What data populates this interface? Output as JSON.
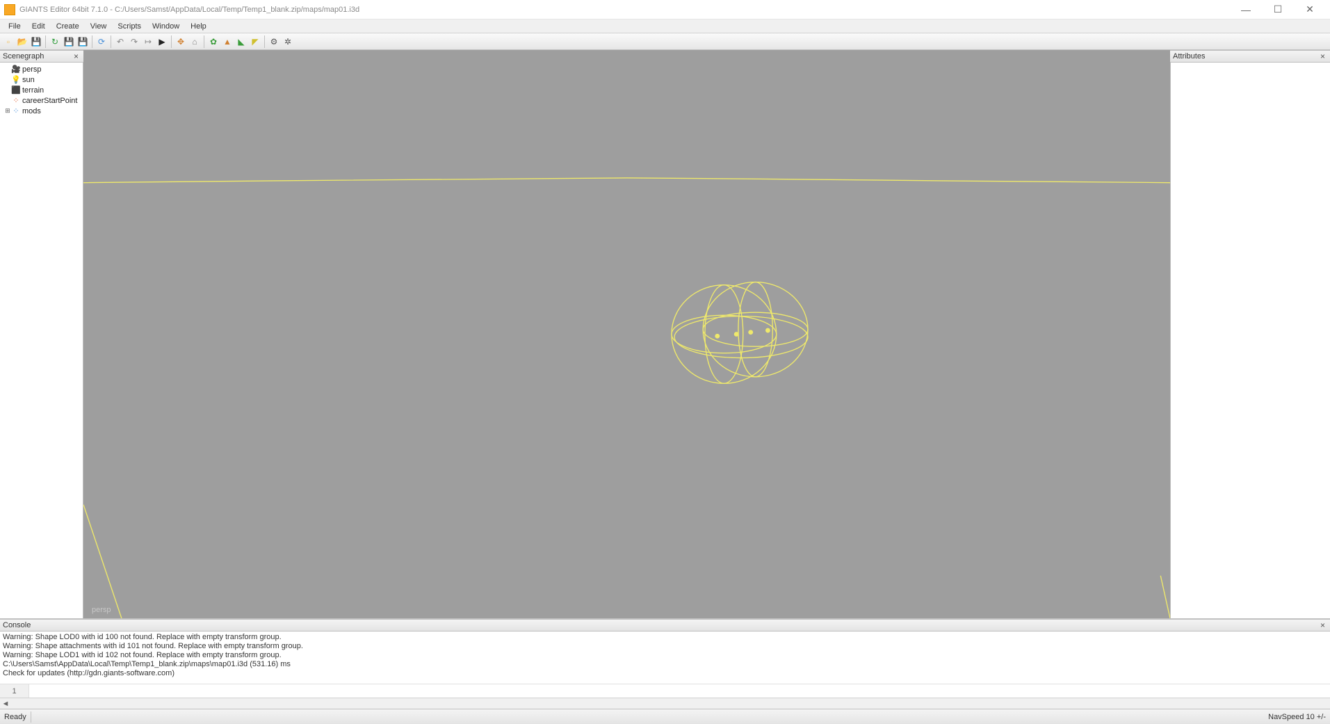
{
  "window": {
    "title": "GIANTS Editor 64bit 7.1.0 - C:/Users/Samst/AppData/Local/Temp/Temp1_blank.zip/maps/map01.i3d"
  },
  "menubar": {
    "items": [
      "File",
      "Edit",
      "Create",
      "View",
      "Scripts",
      "Window",
      "Help"
    ]
  },
  "toolbar": {
    "groups": [
      [
        {
          "name": "new-file-icon",
          "glyph": "▫",
          "color": "#f4c15d"
        },
        {
          "name": "open-file-icon",
          "glyph": "📂",
          "color": "#4a90d9"
        },
        {
          "name": "save-file-icon",
          "glyph": "💾",
          "color": "#4a90d9"
        }
      ],
      [
        {
          "name": "reload-icon",
          "glyph": "↻",
          "color": "#2e9c3a"
        },
        {
          "name": "save-alt-icon",
          "glyph": "💾",
          "color": "#4a90d9"
        },
        {
          "name": "save-all-icon",
          "glyph": "💾",
          "color": "#4a90d9"
        }
      ],
      [
        {
          "name": "cycle-icon",
          "glyph": "⟳",
          "color": "#4a90d9"
        }
      ],
      [
        {
          "name": "undo-icon",
          "glyph": "↶",
          "color": "#888"
        },
        {
          "name": "redo-icon",
          "glyph": "↷",
          "color": "#888"
        },
        {
          "name": "step-icon",
          "glyph": "↦",
          "color": "#888"
        },
        {
          "name": "play-icon",
          "glyph": "▶",
          "color": "#222"
        }
      ],
      [
        {
          "name": "move-tool-icon",
          "glyph": "✥",
          "color": "#d08030"
        },
        {
          "name": "home-icon",
          "glyph": "⌂",
          "color": "#888"
        }
      ],
      [
        {
          "name": "foliage-icon",
          "glyph": "✿",
          "color": "#3a9c3a"
        },
        {
          "name": "brush-a-icon",
          "glyph": "▲",
          "color": "#d08030"
        },
        {
          "name": "brush-b-icon",
          "glyph": "◣",
          "color": "#3a9c3a"
        },
        {
          "name": "brush-c-icon",
          "glyph": "◤",
          "color": "#d0c030"
        }
      ],
      [
        {
          "name": "gear-a-icon",
          "glyph": "⚙",
          "color": "#555"
        },
        {
          "name": "gear-b-icon",
          "glyph": "✲",
          "color": "#555"
        }
      ]
    ]
  },
  "panels": {
    "scenegraph_title": "Scenegraph",
    "attributes_title": "Attributes",
    "console_title": "Console"
  },
  "scenegraph": {
    "items": [
      {
        "label": "persp",
        "icon": "🎥",
        "expander": ""
      },
      {
        "label": "sun",
        "icon": "💡",
        "expander": ""
      },
      {
        "label": "terrain",
        "icon": "⬛",
        "iconColor": "#3a9c3a",
        "expander": ""
      },
      {
        "label": "careerStartPoint",
        "icon": "⁘",
        "iconColor": "#e06030",
        "expander": ""
      },
      {
        "label": "mods",
        "icon": "⁘",
        "iconColor": "#4a90d9",
        "expander": "⊞"
      }
    ]
  },
  "viewport": {
    "camera_label": "persp"
  },
  "console": {
    "lines": [
      "Warning: Shape LOD0 with id 100 not found. Replace with empty transform group.",
      "Warning: Shape attachments with id 101 not found. Replace with empty transform group.",
      "Warning: Shape LOD1 with id 102 not found. Replace with empty transform group.",
      "C:\\Users\\Samst\\AppData\\Local\\Temp\\Temp1_blank.zip\\maps\\map01.i3d (531.16) ms",
      "Check for updates (http://gdn.giants-software.com)"
    ],
    "input_line_number": "1",
    "input_value": ""
  },
  "statusbar": {
    "left": "Ready",
    "right": "NavSpeed 10 +/-"
  }
}
